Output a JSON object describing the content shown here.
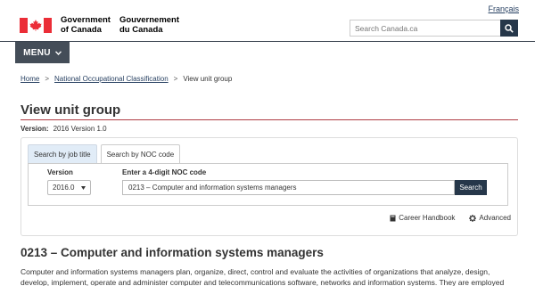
{
  "header": {
    "language_link": "Français",
    "wordmark_en": "Government\nof Canada",
    "wordmark_fr": "Gouvernement\ndu Canada",
    "search_placeholder": "Search Canada.ca",
    "menu_label": "MENU"
  },
  "breadcrumb": {
    "items": [
      "Home",
      "National Occupational Classification",
      "View unit group"
    ],
    "separator": ">"
  },
  "page": {
    "title": "View unit group",
    "version_label": "Version:",
    "version_value": "2016 Version 1.0"
  },
  "search_panel": {
    "tabs": [
      {
        "label": "Search by job title",
        "active": false
      },
      {
        "label": "Search by NOC code",
        "active": true
      }
    ],
    "version_field_label": "Version",
    "version_selected": "2016.0",
    "noc_field_label": "Enter a 4-digit NOC code",
    "noc_value": "0213 – Computer and information systems managers",
    "search_button": "Search"
  },
  "utility_links": [
    {
      "label": "Career Handbook",
      "icon": "book-icon"
    },
    {
      "label": "Advanced",
      "icon": "gear-icon"
    }
  ],
  "unit_group": {
    "heading": "0213 – Computer and information systems managers",
    "description": "Computer and information systems managers plan, organize, direct, control and evaluate the activities of organizations that analyze, design, develop, implement, operate and administer computer and telecommunications software, networks and information systems. They are employed throughout"
  },
  "colors": {
    "flag_red": "#eb2d37",
    "nav_dark": "#444d58",
    "button_dark": "#26374a",
    "link": "#284162",
    "title_rule": "#af3c43",
    "tab_inactive": "#e1ecf7"
  }
}
